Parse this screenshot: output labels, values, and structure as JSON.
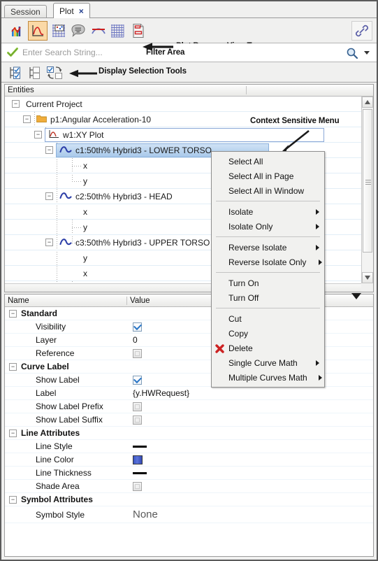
{
  "window": {
    "tabs": [
      {
        "label": "Session",
        "active": false,
        "closable": false
      },
      {
        "label": "Plot",
        "active": true,
        "closable": true,
        "close_glyph": "×"
      }
    ]
  },
  "toolbar": {
    "items": [
      {
        "name": "bar-chart-view-icon",
        "tooltip": "Bar Chart View",
        "selected": false
      },
      {
        "name": "curve-plot-view-icon",
        "tooltip": "Curve Plot View",
        "selected": true
      },
      {
        "name": "datum-view-icon",
        "tooltip": "Datum View",
        "selected": false
      },
      {
        "name": "note-view-icon",
        "tooltip": "Note View",
        "selected": false
      },
      {
        "name": "envelope-view-icon",
        "tooltip": "Envelope View",
        "selected": false
      },
      {
        "name": "grid-view-icon",
        "tooltip": "Grid View",
        "selected": false
      },
      {
        "name": "page-view-icon",
        "tooltip": "Page View",
        "selected": false
      }
    ],
    "link_button": {
      "name": "link-icon",
      "tooltip": "Link"
    },
    "annotation": "Plot Browser View Types"
  },
  "filter": {
    "placeholder": "Enter Search String...",
    "value": "",
    "annotation": "Filter Area",
    "check_icon": "green-check-icon",
    "search_icon": "magnifier-icon",
    "dropdown_icon": "chevron-down-icon"
  },
  "selection_tools": {
    "annotation": "Display Selection Tools",
    "buttons": [
      {
        "name": "select-all-tool",
        "icon": "checked-tree-icon"
      },
      {
        "name": "deselect-all-tool",
        "icon": "unchecked-tree-icon"
      },
      {
        "name": "invert-selection-tool",
        "icon": "swap-selection-icon"
      }
    ]
  },
  "tree": {
    "columns": [
      "Entities",
      ""
    ],
    "annotation": "Context Sensitive Menu",
    "rows": [
      {
        "indent": 0,
        "expander": "−",
        "icon": null,
        "label": "Current Project",
        "state": "normal"
      },
      {
        "indent": 1,
        "expander": "−",
        "icon": "folder-icon",
        "label": "p1:Angular Acceleration-10",
        "state": "normal"
      },
      {
        "indent": 2,
        "expander": "−",
        "icon": "xy-plot-icon",
        "label": "w1:XY Plot",
        "state": "boxed"
      },
      {
        "indent": 3,
        "expander": "−",
        "icon": "curve-icon",
        "label": "c1:50th% Hybrid3  - LOWER TORSO",
        "state": "selected"
      },
      {
        "indent": 4,
        "expander": null,
        "icon": null,
        "label": "x",
        "state": "normal"
      },
      {
        "indent": 4,
        "expander": null,
        "icon": null,
        "label": "y",
        "state": "normal"
      },
      {
        "indent": 3,
        "expander": "−",
        "icon": "curve-icon",
        "label": "c2:50th% Hybrid3  - HEAD",
        "state": "normal"
      },
      {
        "indent": 4,
        "expander": null,
        "icon": null,
        "label": "x",
        "state": "normal"
      },
      {
        "indent": 4,
        "expander": null,
        "icon": null,
        "label": "y",
        "state": "normal"
      },
      {
        "indent": 3,
        "expander": "−",
        "icon": "curve-icon",
        "label": "c3:50th% Hybrid3  - UPPER TORSO",
        "state": "normal"
      },
      {
        "indent": 4,
        "expander": null,
        "icon": null,
        "label": "y",
        "state": "normal"
      },
      {
        "indent": 4,
        "expander": null,
        "icon": null,
        "label": "x",
        "state": "normal"
      }
    ]
  },
  "context_menu": {
    "items": [
      {
        "label": "Select All",
        "submenu": false,
        "icon": null
      },
      {
        "label": "Select All in Page",
        "submenu": false,
        "icon": null
      },
      {
        "label": "Select All in Window",
        "submenu": false,
        "icon": null
      },
      {
        "separator": true
      },
      {
        "label": "Isolate",
        "submenu": true,
        "icon": null
      },
      {
        "label": "Isolate Only",
        "submenu": true,
        "icon": null
      },
      {
        "separator": true
      },
      {
        "label": "Reverse Isolate",
        "submenu": true,
        "icon": null
      },
      {
        "label": "Reverse Isolate Only",
        "submenu": true,
        "icon": null
      },
      {
        "separator": true
      },
      {
        "label": "Turn On",
        "submenu": false,
        "icon": null
      },
      {
        "label": "Turn Off",
        "submenu": false,
        "icon": null
      },
      {
        "separator": true
      },
      {
        "label": "Cut",
        "submenu": false,
        "icon": null
      },
      {
        "label": "Copy",
        "submenu": false,
        "icon": null
      },
      {
        "label": "Delete",
        "submenu": false,
        "icon": "delete-x-icon"
      },
      {
        "label": "Single Curve Math",
        "submenu": true,
        "icon": null
      },
      {
        "label": "Multiple Curves Math",
        "submenu": true,
        "icon": null
      }
    ]
  },
  "properties": {
    "columns": [
      "Name",
      "Value"
    ],
    "groups": [
      {
        "title": "Standard",
        "rows": [
          {
            "name": "Visibility",
            "value_type": "checkbox",
            "value": true
          },
          {
            "name": "Layer",
            "value_type": "text",
            "value": "0"
          },
          {
            "name": "Reference",
            "value_type": "checkbox",
            "value": false
          }
        ]
      },
      {
        "title": "Curve Label",
        "rows": [
          {
            "name": "Show Label",
            "value_type": "checkbox",
            "value": true
          },
          {
            "name": "Label",
            "value_type": "text",
            "value": "{y.HWRequest}"
          },
          {
            "name": "Show Label Prefix",
            "value_type": "checkbox",
            "value": false
          },
          {
            "name": "Show Label Suffix",
            "value_type": "checkbox",
            "value": false
          }
        ]
      },
      {
        "title": "Line Attributes",
        "rows": [
          {
            "name": "Line Style",
            "value_type": "line",
            "value": "solid"
          },
          {
            "name": "Line Color",
            "value_type": "color",
            "value": "#3f57c8"
          },
          {
            "name": "Line Thickness",
            "value_type": "line",
            "value": "thin"
          },
          {
            "name": "Shade Area",
            "value_type": "checkbox",
            "value": false
          }
        ]
      },
      {
        "title": "Symbol Attributes",
        "rows": [
          {
            "name": "Symbol Style",
            "value_type": "text-large",
            "value": "None"
          }
        ]
      }
    ]
  },
  "colors": {
    "selection_blue": "#a9c9ea",
    "toolbar_selected": "#fbd9a6",
    "curve_icon": "#2d3fa8",
    "delete_red": "#cc2222",
    "line_color_value": "#3f57c8"
  }
}
